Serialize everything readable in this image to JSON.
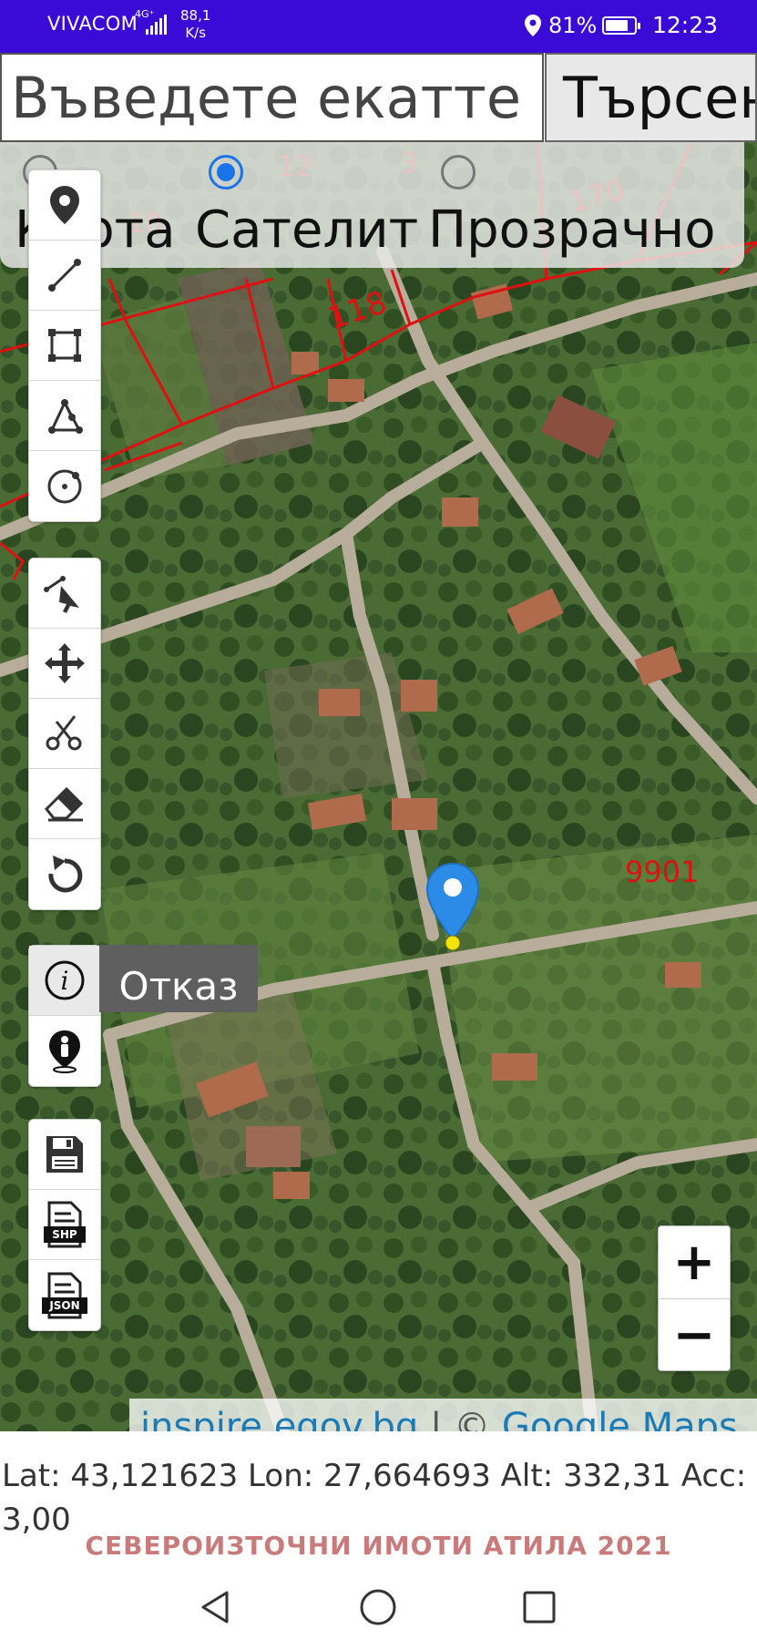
{
  "status_bar": {
    "carrier": "VIVACOM",
    "network": "4G⁺",
    "speed_value": "88,1",
    "speed_unit": "K/s",
    "battery": "81%",
    "battery_level": 0.81,
    "time": "12:23"
  },
  "search": {
    "placeholder": "Въведете екатте",
    "button_label": "Търсене"
  },
  "layers": {
    "options": [
      "Карта",
      "Сателит",
      "Прозрачно"
    ],
    "selected": "Сателит"
  },
  "toolbar_draw": [
    "location-marker-icon",
    "line-icon",
    "rectangle-icon",
    "polygon-icon",
    "circle-icon"
  ],
  "toolbar_edit": [
    "select-pointer-icon",
    "move-icon",
    "scissors-icon",
    "eraser-icon",
    "undo-icon"
  ],
  "toolbar_info": [
    "info-icon",
    "person-location-icon"
  ],
  "cancel_label": "Отказ",
  "toolbar_export": {
    "tools": [
      "save-icon",
      "shp-file-icon",
      "json-file-icon"
    ],
    "shp_label": "SHP",
    "json_label": "JSON"
  },
  "map": {
    "parcel_labels": [
      "18",
      "12",
      "3",
      "170",
      "118",
      "9901"
    ],
    "parcel_color": "#e01010",
    "marker_color": "#2b8be6"
  },
  "zoom": {
    "in_label": "+",
    "out_label": "−"
  },
  "attribution": {
    "link1": "inspire.egov.bg",
    "separator": " | © ",
    "link2": "Google Maps"
  },
  "coords_text": "Lat: 43,121623 Lon: 27,664693 Alt: 332,31 Acc: 3,00",
  "brand": "СЕВЕРОИЗТОЧНИ ИМОТИ АТИЛА 2021",
  "nav": [
    "back-icon",
    "home-icon",
    "recents-icon"
  ]
}
